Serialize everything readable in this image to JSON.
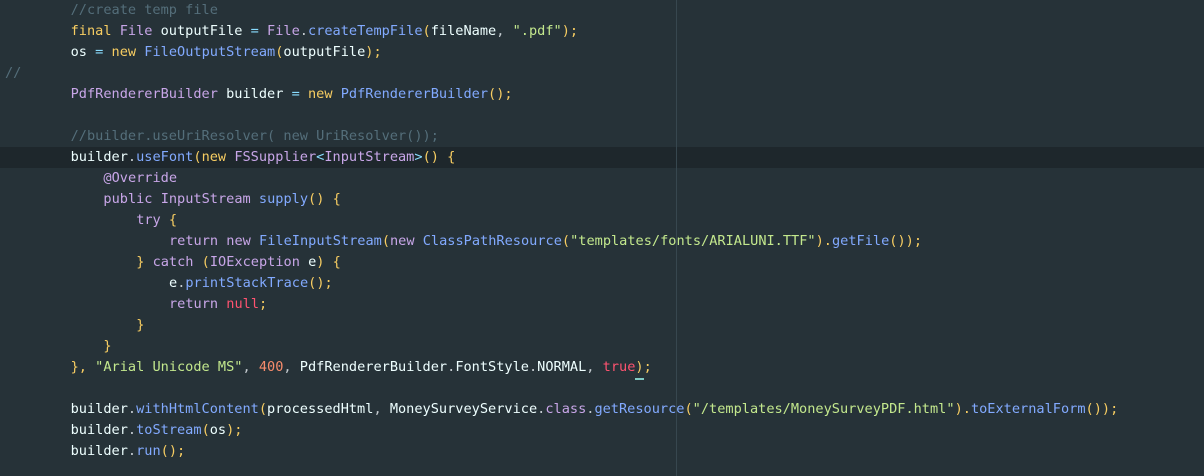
{
  "editor": {
    "colors": {
      "background": "#263238",
      "current_line": "#1e272c",
      "plain": "#c4cbd0",
      "comment": "#546e7a",
      "keyword": "#f7cd62",
      "type": "#c8a6e8",
      "string": "#c3e88d",
      "number": "#f78c6c",
      "method": "#82aaff",
      "operator": "#89ddff",
      "identifier": "#eeffff",
      "constant": "#ff5370"
    },
    "lines": [
      {
        "indent": 8,
        "tokens": [
          {
            "t": "//create temp file",
            "c": "comment"
          }
        ]
      },
      {
        "indent": 8,
        "tokens": [
          {
            "t": "final ",
            "c": "keyword"
          },
          {
            "t": "File ",
            "c": "type"
          },
          {
            "t": "outputFile",
            "c": "identifier"
          },
          {
            "t": " = ",
            "c": "operator"
          },
          {
            "t": "File",
            "c": "type"
          },
          {
            "t": ".",
            "c": "plain"
          },
          {
            "t": "createTempFile",
            "c": "method"
          },
          {
            "t": "(",
            "c": "keyword"
          },
          {
            "t": "fileName",
            "c": "identifier"
          },
          {
            "t": ", ",
            "c": "plain"
          },
          {
            "t": "\".pdf\"",
            "c": "string"
          },
          {
            "t": ");",
            "c": "keyword"
          }
        ]
      },
      {
        "indent": 8,
        "tokens": [
          {
            "t": "os",
            "c": "identifier"
          },
          {
            "t": " = ",
            "c": "operator"
          },
          {
            "t": "new ",
            "c": "keyword"
          },
          {
            "t": "FileOutputStream",
            "c": "method"
          },
          {
            "t": "(",
            "c": "keyword"
          },
          {
            "t": "outputFile",
            "c": "identifier"
          },
          {
            "t": ");",
            "c": "keyword"
          }
        ]
      },
      {
        "indent": 0,
        "tokens": [
          {
            "t": "//",
            "c": "comment"
          }
        ]
      },
      {
        "indent": 8,
        "tokens": [
          {
            "t": "PdfRendererBuilder ",
            "c": "type"
          },
          {
            "t": "builder",
            "c": "identifier"
          },
          {
            "t": " = ",
            "c": "operator"
          },
          {
            "t": "new ",
            "c": "keyword"
          },
          {
            "t": "PdfRendererBuilder",
            "c": "method"
          },
          {
            "t": "();",
            "c": "keyword"
          }
        ]
      },
      {
        "indent": 0,
        "tokens": []
      },
      {
        "indent": 8,
        "tokens": [
          {
            "t": "//builder.useUriResolver( new UriResolver());",
            "c": "comment"
          }
        ]
      },
      {
        "indent": 8,
        "tokens": [
          {
            "t": "builder",
            "c": "identifier"
          },
          {
            "t": ".",
            "c": "plain"
          },
          {
            "t": "useFont",
            "c": "method"
          },
          {
            "t": "(",
            "c": "keyword"
          },
          {
            "t": "new ",
            "c": "keyword"
          },
          {
            "t": "FSSupplier",
            "c": "type"
          },
          {
            "t": "<",
            "c": "operator"
          },
          {
            "t": "InputStream",
            "c": "type"
          },
          {
            "t": ">",
            "c": "operator"
          },
          {
            "t": "() {",
            "c": "keyword"
          }
        ]
      },
      {
        "indent": 12,
        "tokens": [
          {
            "t": "@Override",
            "c": "type"
          }
        ]
      },
      {
        "indent": 12,
        "tokens": [
          {
            "t": "public ",
            "c": "type"
          },
          {
            "t": "InputStream ",
            "c": "type"
          },
          {
            "t": "supply",
            "c": "method"
          },
          {
            "t": "() {",
            "c": "keyword"
          }
        ]
      },
      {
        "indent": 16,
        "tokens": [
          {
            "t": "try",
            "c": "type"
          },
          {
            "t": " {",
            "c": "keyword"
          }
        ]
      },
      {
        "indent": 20,
        "tokens": [
          {
            "t": "return ",
            "c": "type"
          },
          {
            "t": "new ",
            "c": "type"
          },
          {
            "t": "FileInputStream",
            "c": "method"
          },
          {
            "t": "(",
            "c": "keyword"
          },
          {
            "t": "new ",
            "c": "type"
          },
          {
            "t": "ClassPathResource",
            "c": "method"
          },
          {
            "t": "(",
            "c": "keyword"
          },
          {
            "t": "\"templates/fonts/ARIALUNI.TTF\"",
            "c": "string"
          },
          {
            "t": ").",
            "c": "keyword"
          },
          {
            "t": "getFile",
            "c": "method"
          },
          {
            "t": "());",
            "c": "keyword"
          }
        ]
      },
      {
        "indent": 16,
        "tokens": [
          {
            "t": "} ",
            "c": "keyword"
          },
          {
            "t": "catch",
            "c": "type"
          },
          {
            "t": " (",
            "c": "keyword"
          },
          {
            "t": "IOException ",
            "c": "type"
          },
          {
            "t": "e",
            "c": "identifier"
          },
          {
            "t": ") {",
            "c": "keyword"
          }
        ]
      },
      {
        "indent": 20,
        "tokens": [
          {
            "t": "e",
            "c": "identifier"
          },
          {
            "t": ".",
            "c": "plain"
          },
          {
            "t": "printStackTrace",
            "c": "method"
          },
          {
            "t": "();",
            "c": "keyword"
          }
        ]
      },
      {
        "indent": 20,
        "tokens": [
          {
            "t": "return ",
            "c": "type"
          },
          {
            "t": "null",
            "c": "constant"
          },
          {
            "t": ";",
            "c": "keyword"
          }
        ]
      },
      {
        "indent": 16,
        "tokens": [
          {
            "t": "}",
            "c": "keyword"
          }
        ]
      },
      {
        "indent": 12,
        "tokens": [
          {
            "t": "}",
            "c": "keyword"
          }
        ]
      },
      {
        "indent": 8,
        "tokens": [
          {
            "t": "}, ",
            "c": "keyword"
          },
          {
            "t": "\"Arial Unicode MS\"",
            "c": "string"
          },
          {
            "t": ", ",
            "c": "plain"
          },
          {
            "t": "400",
            "c": "number"
          },
          {
            "t": ", ",
            "c": "plain"
          },
          {
            "t": "PdfRendererBuilder",
            "c": "identifier"
          },
          {
            "t": ".",
            "c": "plain"
          },
          {
            "t": "FontStyle",
            "c": "identifier"
          },
          {
            "t": ".",
            "c": "plain"
          },
          {
            "t": "NORMAL",
            "c": "identifier"
          },
          {
            "t": ", ",
            "c": "plain"
          },
          {
            "t": "true",
            "c": "constant"
          },
          {
            "t": ")",
            "c": "keyword",
            "cursor": true
          },
          {
            "t": ";",
            "c": "keyword"
          }
        ]
      },
      {
        "indent": 0,
        "tokens": []
      },
      {
        "indent": 8,
        "tokens": [
          {
            "t": "builder",
            "c": "identifier"
          },
          {
            "t": ".",
            "c": "plain"
          },
          {
            "t": "withHtmlContent",
            "c": "method"
          },
          {
            "t": "(",
            "c": "keyword"
          },
          {
            "t": "processedHtml",
            "c": "identifier"
          },
          {
            "t": ", ",
            "c": "plain"
          },
          {
            "t": "MoneySurveyService",
            "c": "identifier"
          },
          {
            "t": ".",
            "c": "plain"
          },
          {
            "t": "class",
            "c": "type"
          },
          {
            "t": ".",
            "c": "plain"
          },
          {
            "t": "getResource",
            "c": "method"
          },
          {
            "t": "(",
            "c": "keyword"
          },
          {
            "t": "\"/templates/MoneySurveyPDF.html\"",
            "c": "string"
          },
          {
            "t": ").",
            "c": "keyword"
          },
          {
            "t": "toExternalForm",
            "c": "method"
          },
          {
            "t": "());",
            "c": "keyword"
          }
        ]
      },
      {
        "indent": 8,
        "tokens": [
          {
            "t": "builder",
            "c": "identifier"
          },
          {
            "t": ".",
            "c": "plain"
          },
          {
            "t": "toStream",
            "c": "method"
          },
          {
            "t": "(",
            "c": "keyword"
          },
          {
            "t": "os",
            "c": "identifier"
          },
          {
            "t": ");",
            "c": "keyword"
          }
        ]
      },
      {
        "indent": 8,
        "tokens": [
          {
            "t": "builder",
            "c": "identifier"
          },
          {
            "t": ".",
            "c": "plain"
          },
          {
            "t": "run",
            "c": "method"
          },
          {
            "t": "();",
            "c": "keyword"
          }
        ]
      }
    ]
  }
}
